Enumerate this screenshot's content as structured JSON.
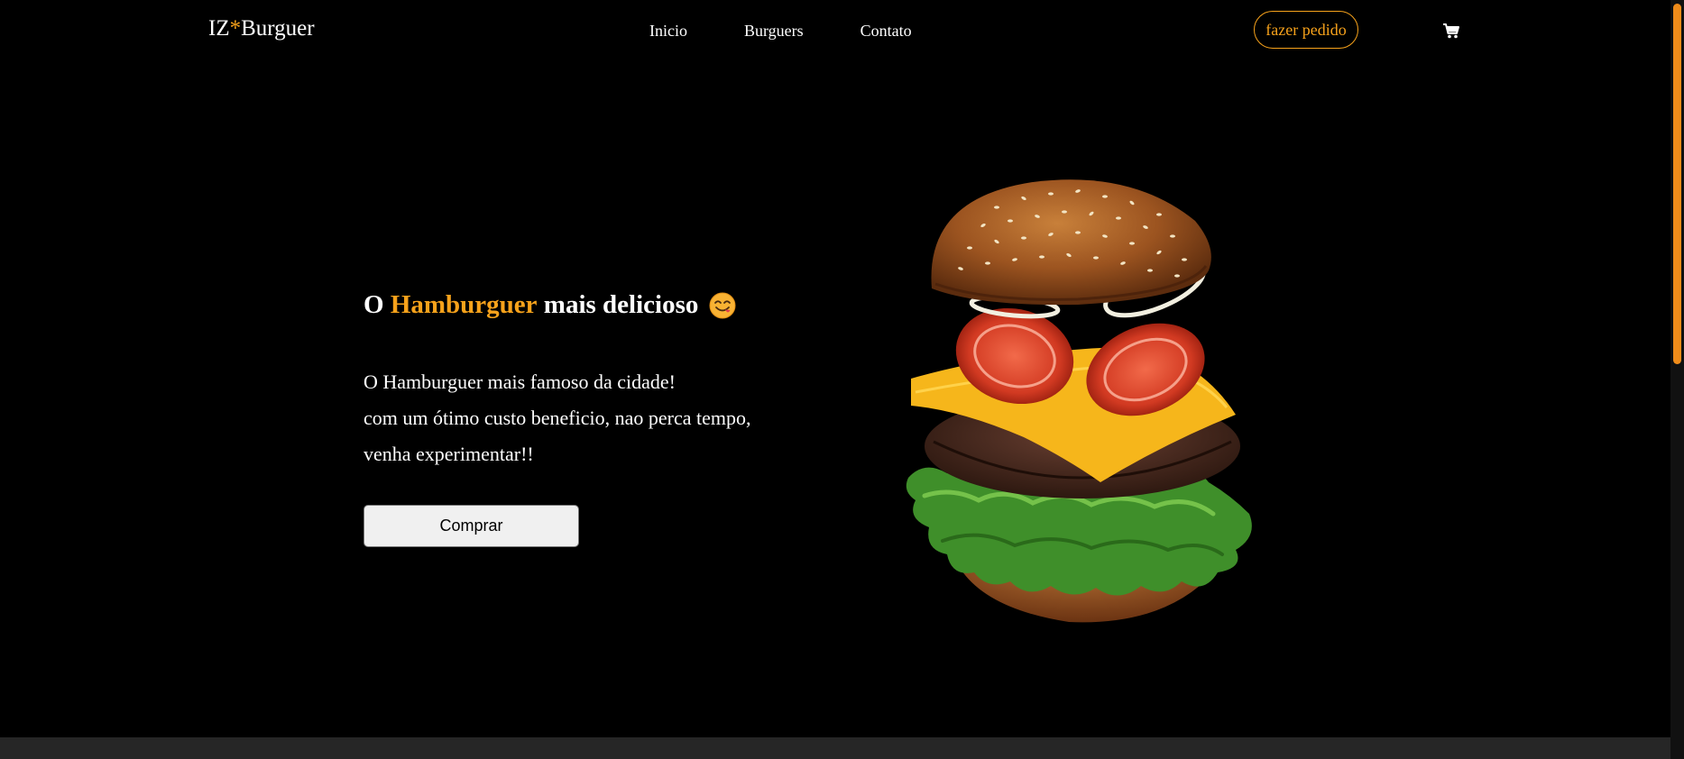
{
  "header": {
    "logo_prefix": "IZ",
    "logo_star": "*",
    "logo_suffix": "Burguer",
    "nav": [
      {
        "label": "Inicio"
      },
      {
        "label": "Burguers"
      },
      {
        "label": "Contato"
      }
    ],
    "order_button": "fazer pedido",
    "cart_icon": "shopping-cart-icon"
  },
  "hero": {
    "title_start": "O ",
    "title_accent": "Hamburguer",
    "title_end": " mais delicioso",
    "title_emoji_icon": "yum-face-icon",
    "text_lines": [
      "O Hamburguer mais famoso da cidade!",
      "com um ótimo custo beneficio, nao perca tempo,",
      "venha experimentar!!"
    ],
    "buy_button": "Comprar",
    "image_icon": "burger-image"
  },
  "colors": {
    "accent": "#f7a21b",
    "background": "#000000",
    "text": "#ffffff"
  }
}
